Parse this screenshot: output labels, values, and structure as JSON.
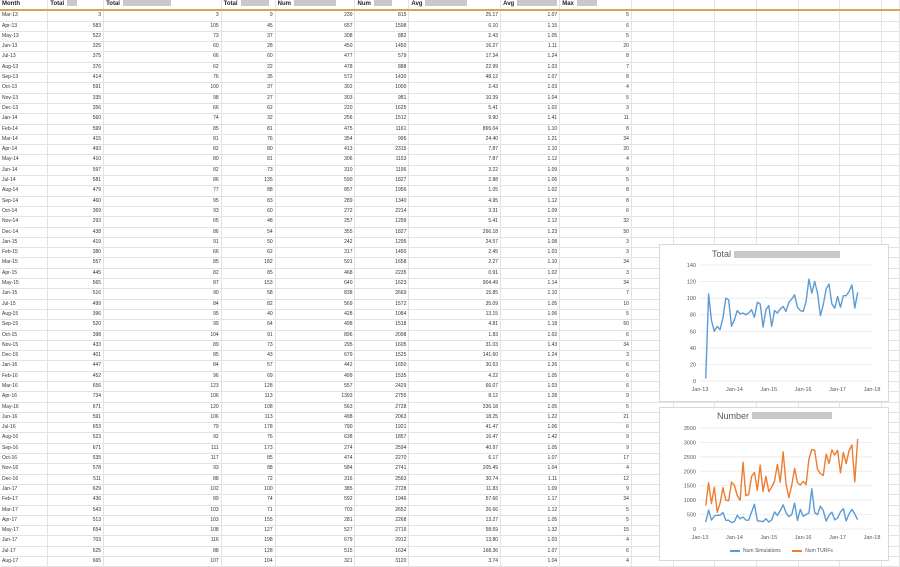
{
  "sheet": {
    "headers": [
      "Month",
      "Total",
      "Total",
      "Total",
      "Num",
      "Num",
      "Avg",
      "Avg",
      "Max"
    ],
    "header_redaction_widths": [
      0,
      10,
      48,
      28,
      42,
      18,
      42,
      40,
      20
    ],
    "rows": [
      [
        "Mar-13",
        "3",
        "3",
        "9",
        "239",
        "815",
        "25.17",
        "1.07",
        "5"
      ],
      [
        "Apr-13",
        "583",
        "105",
        "45",
        "657",
        "1598",
        "6.10",
        "1.15",
        "6"
      ],
      [
        "May-13",
        "522",
        "73",
        "37",
        "308",
        "882",
        "2.43",
        "1.05",
        "5"
      ],
      [
        "Jun-13",
        "325",
        "60",
        "28",
        "450",
        "1450",
        "16.27",
        "1.11",
        "20"
      ],
      [
        "Jul-13",
        "375",
        "66",
        "60",
        "477",
        "579",
        "17.34",
        "1.24",
        "8"
      ],
      [
        "Aug-13",
        "376",
        "62",
        "22",
        "478",
        "888",
        "22.99",
        "1.03",
        "7"
      ],
      [
        "Sep-13",
        "414",
        "76",
        "35",
        "572",
        "1430",
        "48.12",
        "1.07",
        "8"
      ],
      [
        "Oct-13",
        "591",
        "100",
        "37",
        "302",
        "1000",
        "2.43",
        "1.03",
        "4"
      ],
      [
        "Nov-13",
        "335",
        "98",
        "27",
        "303",
        "981",
        "10.39",
        "1.04",
        "5"
      ],
      [
        "Dec-13",
        "356",
        "66",
        "62",
        "220",
        "1625",
        "5.41",
        "1.02",
        "3"
      ],
      [
        "Jan-14",
        "560",
        "74",
        "32",
        "256",
        "1512",
        "9.90",
        "1.41",
        "11"
      ],
      [
        "Feb-14",
        "599",
        "85",
        "81",
        "475",
        "1161",
        "865.04",
        "1.10",
        "8"
      ],
      [
        "Mar-14",
        "415",
        "81",
        "76",
        "354",
        "995",
        "24.40",
        "1.21",
        "34"
      ],
      [
        "Apr-14",
        "493",
        "82",
        "80",
        "413",
        "2315",
        "7.87",
        "1.10",
        "20"
      ],
      [
        "May-14",
        "410",
        "80",
        "81",
        "306",
        "1153",
        "7.87",
        "1.12",
        "4"
      ],
      [
        "Jun-14",
        "597",
        "82",
        "73",
        "310",
        "1196",
        "3.22",
        "1.09",
        "9"
      ],
      [
        "Jul-14",
        "581",
        "86",
        "135",
        "590",
        "1827",
        "2.88",
        "1.06",
        "5"
      ],
      [
        "Aug-14",
        "479",
        "77",
        "88",
        "857",
        "1956",
        "1.05",
        "1.02",
        "8"
      ],
      [
        "Sep-14",
        "460",
        "95",
        "83",
        "289",
        "1340",
        "4.95",
        "1.12",
        "8"
      ],
      [
        "Oct-14",
        "369",
        "93",
        "60",
        "272",
        "2214",
        "3.31",
        "1.09",
        "6"
      ],
      [
        "Nov-14",
        "293",
        "65",
        "48",
        "257",
        "1299",
        "5.41",
        "1.12",
        "32"
      ],
      [
        "Dec-14",
        "438",
        "86",
        "54",
        "355",
        "1827",
        "266.18",
        "1.23",
        "50"
      ],
      [
        "Jan-15",
        "419",
        "91",
        "50",
        "242",
        "1295",
        "24.57",
        "1.08",
        "3"
      ],
      [
        "Feb-15",
        "380",
        "66",
        "62",
        "317",
        "1450",
        "2.45",
        "1.03",
        "3"
      ],
      [
        "Mar-15",
        "557",
        "85",
        "182",
        "591",
        "1658",
        "2.27",
        "1.10",
        "34"
      ],
      [
        "Apr-15",
        "445",
        "82",
        "85",
        "468",
        "2235",
        "0.91",
        "1.02",
        "3"
      ],
      [
        "May-15",
        "565",
        "87",
        "153",
        "640",
        "1623",
        "904.49",
        "1.14",
        "34"
      ],
      [
        "Jun-15",
        "516",
        "90",
        "58",
        "838",
        "2669",
        "15.85",
        "1.10",
        "7"
      ],
      [
        "Jul-15",
        "499",
        "84",
        "82",
        "569",
        "1572",
        "35.09",
        "1.05",
        "10"
      ],
      [
        "Aug-15",
        "396",
        "95",
        "40",
        "428",
        "1084",
        "13.15",
        "1.06",
        "5"
      ],
      [
        "Sep-15",
        "520",
        "99",
        "64",
        "498",
        "1518",
        "4.81",
        "1.18",
        "50"
      ],
      [
        "Oct-15",
        "398",
        "104",
        "91",
        "896",
        "2098",
        "1.83",
        "1.02",
        "6"
      ],
      [
        "Nov-15",
        "433",
        "89",
        "73",
        "295",
        "1605",
        "31.03",
        "1.43",
        "34"
      ],
      [
        "Dec-15",
        "401",
        "85",
        "43",
        "679",
        "1525",
        "141.60",
        "1.24",
        "3"
      ],
      [
        "Jan-16",
        "447",
        "84",
        "57",
        "442",
        "1650",
        "30.53",
        "1.26",
        "6"
      ],
      [
        "Feb-16",
        "452",
        "96",
        "69",
        "499",
        "1535",
        "4.22",
        "1.05",
        "6"
      ],
      [
        "Mar-16",
        "656",
        "123",
        "128",
        "557",
        "2429",
        "66.07",
        "1.03",
        "6"
      ],
      [
        "Apr-16",
        "734",
        "106",
        "113",
        "1393",
        "2755",
        "8.12",
        "1.28",
        "9"
      ],
      [
        "May-16",
        "671",
        "120",
        "108",
        "563",
        "2728",
        "336.18",
        "1.05",
        "5"
      ],
      [
        "Jun-16",
        "591",
        "106",
        "113",
        "498",
        "2063",
        "18.25",
        "1.22",
        "21"
      ],
      [
        "Jul-16",
        "653",
        "79",
        "178",
        "790",
        "1921",
        "41.47",
        "1.06",
        "6"
      ],
      [
        "Aug-16",
        "523",
        "92",
        "76",
        "638",
        "1857",
        "16.47",
        "1.42",
        "9"
      ],
      [
        "Sep-16",
        "671",
        "111",
        "173",
        "274",
        "2594",
        "40.97",
        "1.05",
        "9"
      ],
      [
        "Oct-16",
        "535",
        "117",
        "85",
        "474",
        "2270",
        "6.17",
        "1.07",
        "17"
      ],
      [
        "Nov-16",
        "578",
        "93",
        "88",
        "584",
        "2741",
        "205.49",
        "1.04",
        "4"
      ],
      [
        "Dec-16",
        "511",
        "88",
        "72",
        "316",
        "2563",
        "30.74",
        "1.11",
        "12"
      ],
      [
        "Jan-17",
        "629",
        "102",
        "100",
        "385",
        "2728",
        "11.83",
        "1.09",
        "9"
      ],
      [
        "Feb-17",
        "436",
        "89",
        "74",
        "592",
        "1946",
        "57.66",
        "1.17",
        "34"
      ],
      [
        "Mar-17",
        "543",
        "103",
        "71",
        "703",
        "2652",
        "26.66",
        "1.12",
        "5"
      ],
      [
        "Apr-17",
        "513",
        "103",
        "155",
        "281",
        "2268",
        "13.27",
        "1.05",
        "5"
      ],
      [
        "May-17",
        "654",
        "108",
        "127",
        "527",
        "2719",
        "58.69",
        "1.32",
        "15"
      ],
      [
        "Jun-17",
        "703",
        "116",
        "198",
        "679",
        "2912",
        "13.80",
        "1.03",
        "4"
      ],
      [
        "Jul-17",
        "625",
        "88",
        "128",
        "515",
        "1634",
        "168.36",
        "1.07",
        "6"
      ],
      [
        "Aug-17",
        "665",
        "107",
        "104",
        "321",
        "3120",
        "3.74",
        "1.04",
        "4"
      ]
    ]
  },
  "chart_data": [
    {
      "type": "line",
      "title": "Total",
      "xlabel": "",
      "ylabel": "",
      "ylim": [
        0,
        140
      ],
      "yticks": [
        "0",
        "20",
        "40",
        "60",
        "80",
        "100",
        "120",
        "140"
      ],
      "xticks": [
        "Jan-13",
        "Jan-14",
        "Jan-15",
        "Jan-16",
        "Jan-17",
        "Jan-18"
      ],
      "x_range": [
        "Jan-13",
        "Jan-18"
      ],
      "grid": true,
      "legend": "none",
      "series": [
        {
          "color": "#5b9bd5",
          "values": [
            3,
            105,
            73,
            60,
            66,
            62,
            76,
            100,
            98,
            66,
            74,
            85,
            81,
            82,
            80,
            82,
            86,
            77,
            95,
            93,
            65,
            86,
            91,
            66,
            85,
            82,
            87,
            90,
            84,
            95,
            99,
            104,
            89,
            85,
            84,
            96,
            123,
            106,
            120,
            106,
            79,
            92,
            111,
            117,
            93,
            88,
            102,
            89,
            103,
            103,
            108,
            116,
            88,
            107
          ]
        }
      ]
    },
    {
      "type": "line",
      "title": "Number",
      "xlabel": "",
      "ylabel": "",
      "ylim": [
        0,
        3500
      ],
      "yticks": [
        "0",
        "500",
        "1000",
        "1500",
        "2000",
        "2500",
        "3000",
        "3500"
      ],
      "xticks": [
        "Jan-13",
        "Jan-14",
        "Jan-15",
        "Jan-16",
        "Jan-17",
        "Jan-18"
      ],
      "x_range": [
        "Jan-13",
        "Jan-18"
      ],
      "grid": true,
      "legend": "bottom",
      "series": [
        {
          "name": "Num Simulations",
          "color": "#5b9bd5",
          "values": [
            239,
            657,
            308,
            450,
            477,
            478,
            572,
            302,
            303,
            220,
            256,
            475,
            354,
            413,
            306,
            310,
            590,
            857,
            289,
            272,
            257,
            355,
            242,
            317,
            591,
            468,
            640,
            838,
            569,
            428,
            498,
            896,
            295,
            679,
            442,
            499,
            557,
            1393,
            563,
            498,
            790,
            638,
            274,
            474,
            584,
            316,
            385,
            592,
            703,
            281,
            527,
            679,
            515,
            321
          ]
        },
        {
          "name": "Num TURFs",
          "color": "#ed7d31",
          "values": [
            815,
            1598,
            882,
            1450,
            579,
            888,
            1430,
            1000,
            981,
            1625,
            1512,
            1161,
            995,
            2315,
            1153,
            1196,
            1827,
            1956,
            1340,
            2214,
            1299,
            1827,
            1295,
            1450,
            1658,
            2235,
            1623,
            2669,
            1572,
            1084,
            1518,
            2098,
            1605,
            1525,
            1650,
            1535,
            2429,
            2755,
            2728,
            2063,
            1921,
            1857,
            2594,
            2270,
            2741,
            2563,
            2728,
            1946,
            2652,
            2268,
            2719,
            2912,
            1634,
            3120
          ]
        }
      ]
    }
  ]
}
